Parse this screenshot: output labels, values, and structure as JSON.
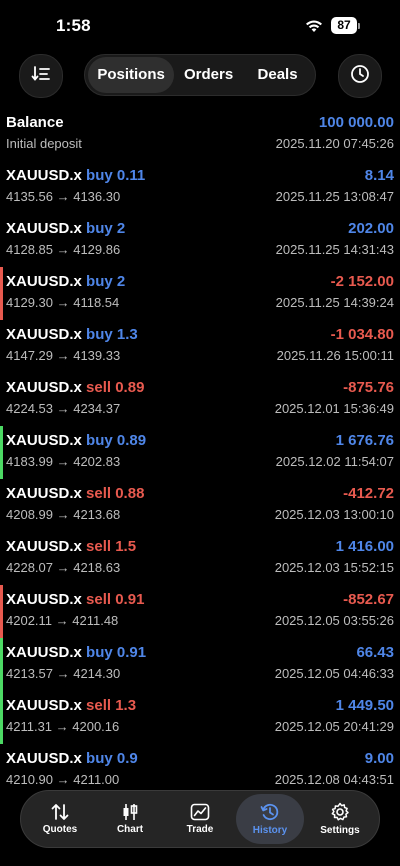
{
  "status": {
    "time": "1:58",
    "battery": "87"
  },
  "segments": {
    "positions": "Positions",
    "orders": "Orders",
    "deals": "Deals"
  },
  "balance": {
    "title": "Balance",
    "subtitle": "Initial deposit",
    "amount": "100 000.00",
    "time": "2025.11.20 07:45:26"
  },
  "deals": [
    {
      "symbol": "XAUUSD.x",
      "side": "buy 0.11",
      "side_color": "#4f86e8",
      "prices": "4135.56 → 4136.30",
      "profit": "8.14",
      "profit_color": "#4f86e8",
      "time": "2025.11.25 13:08:47",
      "bar": ""
    },
    {
      "symbol": "XAUUSD.x",
      "side": "buy 2",
      "side_color": "#4f86e8",
      "prices": "4128.85 → 4129.86",
      "profit": "202.00",
      "profit_color": "#4f86e8",
      "time": "2025.11.25 14:31:43",
      "bar": ""
    },
    {
      "symbol": "XAUUSD.x",
      "side": "buy 2",
      "side_color": "#4f86e8",
      "prices": "4129.30 → 4118.54",
      "profit": "-2 152.00",
      "profit_color": "#e85a4f",
      "time": "2025.11.25 14:39:24",
      "bar": "#e85a4f"
    },
    {
      "symbol": "XAUUSD.x",
      "side": "buy 1.3",
      "side_color": "#4f86e8",
      "prices": "4147.29 → 4139.33",
      "profit": "-1 034.80",
      "profit_color": "#e85a4f",
      "time": "2025.11.26 15:00:11",
      "bar": ""
    },
    {
      "symbol": "XAUUSD.x",
      "side": "sell 0.89",
      "side_color": "#e85a4f",
      "prices": "4224.53 → 4234.37",
      "profit": "-875.76",
      "profit_color": "#e85a4f",
      "time": "2025.12.01 15:36:49",
      "bar": ""
    },
    {
      "symbol": "XAUUSD.x",
      "side": "buy 0.89",
      "side_color": "#4f86e8",
      "prices": "4183.99 → 4202.83",
      "profit": "1 676.76",
      "profit_color": "#4f86e8",
      "time": "2025.12.02 11:54:07",
      "bar": "#4cd964"
    },
    {
      "symbol": "XAUUSD.x",
      "side": "sell 0.88",
      "side_color": "#e85a4f",
      "prices": "4208.99 → 4213.68",
      "profit": "-412.72",
      "profit_color": "#e85a4f",
      "time": "2025.12.03 13:00:10",
      "bar": ""
    },
    {
      "symbol": "XAUUSD.x",
      "side": "sell 1.5",
      "side_color": "#e85a4f",
      "prices": "4228.07 → 4218.63",
      "profit": "1 416.00",
      "profit_color": "#4f86e8",
      "time": "2025.12.03 15:52:15",
      "bar": ""
    },
    {
      "symbol": "XAUUSD.x",
      "side": "sell 0.91",
      "side_color": "#e85a4f",
      "prices": "4202.11 → 4211.48",
      "profit": "-852.67",
      "profit_color": "#e85a4f",
      "time": "2025.12.05 03:55:26",
      "bar": "#e85a4f"
    },
    {
      "symbol": "XAUUSD.x",
      "side": "buy 0.91",
      "side_color": "#4f86e8",
      "prices": "4213.57 → 4214.30",
      "profit": "66.43",
      "profit_color": "#4f86e8",
      "time": "2025.12.05 04:46:33",
      "bar": "#4cd964"
    },
    {
      "symbol": "XAUUSD.x",
      "side": "sell 1.3",
      "side_color": "#e85a4f",
      "prices": "4211.31 → 4200.16",
      "profit": "1 449.50",
      "profit_color": "#4f86e8",
      "time": "2025.12.05 20:41:29",
      "bar": "#4cd964"
    },
    {
      "symbol": "XAUUSD.x",
      "side": "buy 0.9",
      "side_color": "#4f86e8",
      "prices": "4210.90 → 4211.00",
      "profit": "9.00",
      "profit_color": "#4f86e8",
      "time": "2025.12.08 04:43:51",
      "bar": ""
    }
  ],
  "tabs": [
    {
      "key": "quotes",
      "label": "Quotes",
      "icon": "quotes-icon"
    },
    {
      "key": "chart",
      "label": "Chart",
      "icon": "chart-icon"
    },
    {
      "key": "trade",
      "label": "Trade",
      "icon": "trade-icon"
    },
    {
      "key": "history",
      "label": "History",
      "icon": "history-icon",
      "active": true
    },
    {
      "key": "settings",
      "label": "Settings",
      "icon": "settings-icon"
    }
  ]
}
